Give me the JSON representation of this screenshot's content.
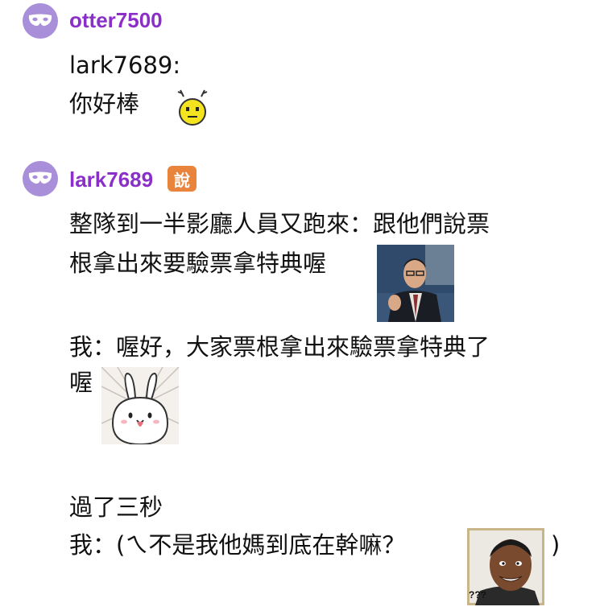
{
  "messages": [
    {
      "username": "otter7500",
      "lines": [
        "lark7689:",
        "你好棒"
      ],
      "stickers": [
        "smiley-emoji"
      ]
    },
    {
      "username": "lark7689",
      "badge": "說",
      "lines": [
        "整隊到一半影廳人員又跑來：跟他們說票",
        "根拿出來要驗票拿特典喔",
        "我：喔好，大家票根拿出來驗票拿特典了",
        "喔",
        "過了三秒",
        "我：(ㄟ不是我他媽到底在幹嘛？",
        ")"
      ],
      "stickers": [
        "man-in-suit-photo",
        "white-bunny-sticker",
        "confused-man-photo"
      ],
      "sticker_text": "???"
    }
  ],
  "colors": {
    "avatar": "#a98fd9",
    "username": "#8b2fc9",
    "badge": "#e8843b"
  }
}
